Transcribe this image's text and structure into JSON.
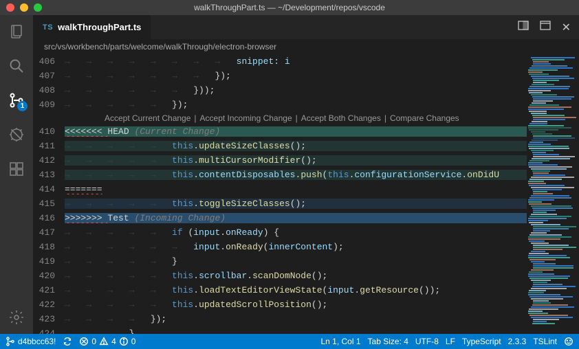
{
  "window": {
    "title": "walkThroughPart.ts — ~/Development/repos/vscode"
  },
  "activityBar": {
    "scmBadge": "1"
  },
  "tab": {
    "icon": "TS",
    "filename": "walkThroughPart.ts"
  },
  "breadcrumb": {
    "path": "src/vs/workbench/parts/welcome/walkThrough/electron-browser"
  },
  "codelens": {
    "acceptCurrent": "Accept Current Change",
    "acceptIncoming": "Accept Incoming Change",
    "acceptBoth": "Accept Both Changes",
    "compare": "Compare Changes"
  },
  "lines": {
    "l406": "406",
    "l407": "407",
    "l408": "408",
    "l409": "409",
    "l410": "410",
    "l411": "411",
    "l412": "412",
    "l413": "413",
    "l414": "414",
    "l415": "415",
    "l416": "416",
    "l417": "417",
    "l418": "418",
    "l419": "419",
    "l420": "420",
    "l421": "421",
    "l422": "422",
    "l423": "423",
    "l424": "424"
  },
  "conflict": {
    "headMarker": "<<<<<<< ",
    "headRef": "HEAD",
    "currentLabel": " (Current Change)",
    "divider": "=======",
    "incomingMarker": ">>>>>>> ",
    "incomingRef": "Test",
    "incomingLabel": " (Incoming Change)"
  },
  "code": {
    "snippet": "snippet: i",
    "closeBraceParenSemi": "});",
    "closeBraceParenParenSemi": "}));",
    "this": "this",
    "dot": ".",
    "updateSizeClasses": "updateSizeClasses",
    "multiCursorModifier": "multiCursorModifier",
    "contentDisposables": "contentDisposables",
    "push": "push",
    "configurationService": "configurationService",
    "onDidU": "onDidU",
    "toggleSizeClasses": "toggleSizeClasses",
    "if": "if",
    "input": "input",
    "onReady": "onReady",
    "innerContent": "innerContent",
    "scrollbar": "scrollbar",
    "scanDomNode": "scanDomNode",
    "loadTextEditorViewState": "loadTextEditorViewState",
    "getResource": "getResource",
    "updatedScrollPosition": "updatedScrollPosition",
    "emptyCall": "();",
    "openParen": "(",
    "closeParen": ")",
    "semi": ";",
    "openBrace": " {",
    "closeBrace": "}"
  },
  "statusbar": {
    "branch": "d4bbcc63!",
    "errors": "0",
    "warnings": "4",
    "info": "0",
    "cursor": "Ln 1, Col 1",
    "tabSize": "Tab Size: 4",
    "encoding": "UTF-8",
    "eol": "LF",
    "language": "TypeScript",
    "tsVersion": "2.3.3",
    "tslint": "TSLint"
  }
}
